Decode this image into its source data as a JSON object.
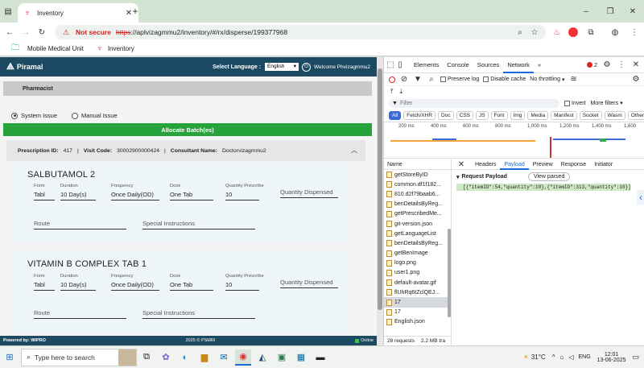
{
  "browser": {
    "tab_title": "Inventory",
    "url_warning": "Not secure",
    "url_scheme": "https",
    "url_rest": "://aplvizagmmu2/inventory/#/rx/disperse/199377968",
    "bookmarks": [
      "Mobile Medical Unit",
      "Inventory"
    ]
  },
  "app": {
    "brand": "Piramal",
    "select_language_label": "Select Language :",
    "language_value": "English",
    "welcome": "Welcome Phvizagmmu2",
    "section_title": "Pharmacist",
    "radio_system": "System Issue",
    "radio_manual": "Manual Issue",
    "allocate_button": "Allocate Batch(es)",
    "prescription": {
      "id_label": "Prescription ID:",
      "id": "417",
      "visit_label": "Visit Code:",
      "visit": "30002900000424",
      "consultant_label": "Consultant Name:",
      "consultant": "Doctorvizagmmu2"
    },
    "labels": {
      "form": "Form",
      "duration": "Duration",
      "frequency": "Frequency",
      "dose": "Dose",
      "qty_prescribe": "Quantity Prescribe",
      "qty_dispensed": "Quantity Dispensed",
      "route": "Route",
      "special": "Special Instructions"
    },
    "drugs": [
      {
        "name": "SALBUTAMOL 2",
        "form": "Tabl",
        "duration": "10 Day(s)",
        "frequency": "Once Daily(OD)",
        "dose": "One Tab",
        "qty": "10"
      },
      {
        "name": "VITAMIN B COMPLEX TAB 1",
        "form": "Tabl",
        "duration": "10 Day(s)",
        "frequency": "Once Daily(OD)",
        "dose": "One Tab",
        "qty": "10"
      }
    ],
    "footer_left": "Powered by: WIPRO",
    "footer_center": "2025 © PSMRI",
    "footer_right": "Online"
  },
  "devtools": {
    "tabs": [
      "Elements",
      "Console",
      "Sources",
      "Network"
    ],
    "badge": "2",
    "preserve_log": "Preserve log",
    "disable_cache": "Disable cache",
    "throttling": "No throttling",
    "filter_placeholder": "Filter",
    "invert": "Invert",
    "more_filters": "More filters",
    "type_chips": [
      "All",
      "Fetch/XHR",
      "Doc",
      "CSS",
      "JS",
      "Font",
      "Img",
      "Media",
      "Manifest",
      "Socket",
      "Wasm",
      "Other"
    ],
    "timeline_ticks": [
      "200 ms",
      "400 ms",
      "600 ms",
      "800 ms",
      "1,000 ms",
      "1,200 ms",
      "1,400 ms",
      "1,600"
    ],
    "name_header": "Name",
    "requests": [
      "getStoreByID",
      "common.df1f182...",
      "810.d2f79baab6...",
      "benDetailsByReg...",
      "getPrescribedMe...",
      "git-version.json",
      "getLanguageList",
      "benDetailsByReg...",
      "getBenImage",
      "logo.png",
      "user1.png",
      "default-avatar.gif",
      "flUhRq6tZclQEJ...",
      "17",
      "17",
      "English.json"
    ],
    "selected_request": "17",
    "detail_tabs": [
      "Headers",
      "Payload",
      "Preview",
      "Response",
      "Initiator"
    ],
    "request_payload_label": "Request Payload",
    "view_parsed": "View parsed",
    "payload": "[{\"itemID\":54,\"quantity\":10},{\"itemID\":313,\"quantity\":10}]",
    "status_requests": "28 requests",
    "status_transfer": "2.2 MB tra"
  },
  "taskbar": {
    "search_placeholder": "Type here to search",
    "weather": "31°C",
    "language": "ENG",
    "time": "12:01",
    "date": "13-06-2025"
  }
}
